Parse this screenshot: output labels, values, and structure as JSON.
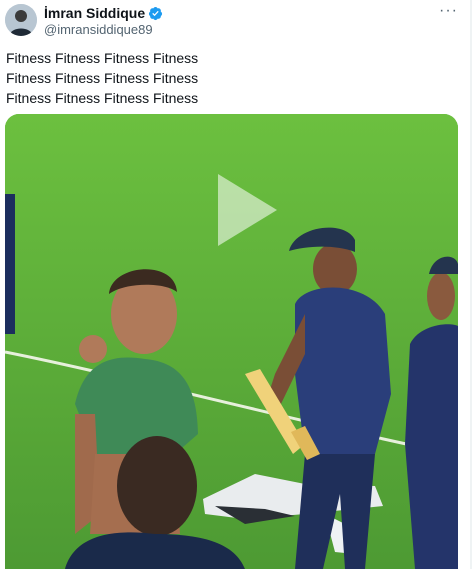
{
  "post": {
    "author_name": "İmran Siddique",
    "author_handle": "@imransiddique89",
    "verified_icon": "verified-badge-icon",
    "more_label": "···",
    "text_lines": [
      "Fitness Fitness Fitness Fitness",
      "Fitness Fitness Fitness Fitness",
      "Fitness Fitness Fitness Fitness"
    ]
  },
  "media": {
    "type": "video",
    "play_icon": "play-icon"
  },
  "colors": {
    "verified": "#1d9bf0",
    "handle": "#536471",
    "text": "#0f1419",
    "field": "#5fb33a"
  }
}
